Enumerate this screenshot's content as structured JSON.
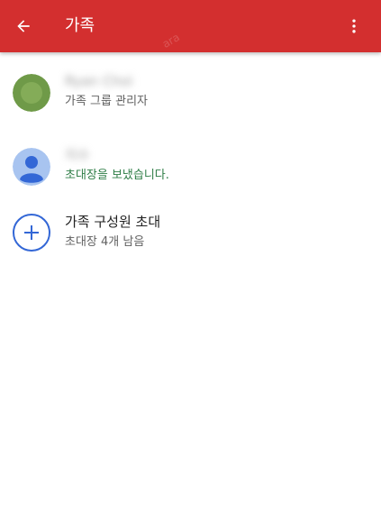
{
  "appbar": {
    "title": "가족",
    "back_icon": "arrow-back-icon",
    "more_icon": "more-vert-icon",
    "watermark": "ara"
  },
  "members": [
    {
      "name": "Ryan Choi",
      "subtitle": "가족 그룹 관리자",
      "avatar": "green-photo-avatar"
    },
    {
      "name": "지수",
      "subtitle": "초대장을 보냈습니다.",
      "avatar": "default-person-avatar"
    }
  ],
  "invite": {
    "label": "가족 구성원 초대",
    "subtitle": "초대장 4개 남음",
    "icon": "add-circle-icon"
  },
  "colors": {
    "appbar": "#d32f2f",
    "accent_text": "#2e7d46",
    "invite_icon": "#3367d6",
    "avatar_green": "#6f9a48",
    "avatar_blue_bg": "#a8c4f0",
    "avatar_blue_fg": "#3367d6"
  }
}
